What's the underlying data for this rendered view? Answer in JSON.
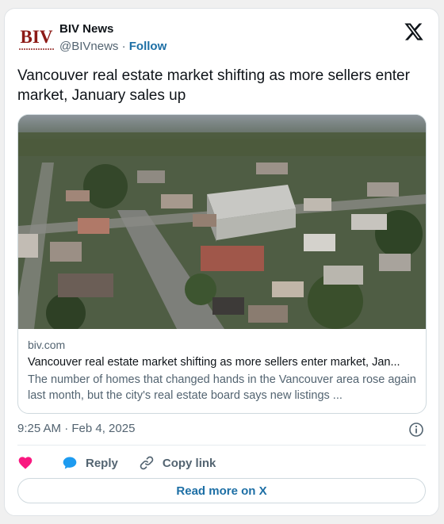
{
  "author": {
    "avatar_text": "BIV",
    "name": "BIV News",
    "handle": "@BIVnews",
    "separator": "·",
    "follow_label": "Follow"
  },
  "tweet": {
    "text": "Vancouver real estate market shifting as more sellers enter market, January sales up"
  },
  "link_card": {
    "domain": "biv.com",
    "title": "Vancouver real estate market shifting as more sellers enter market, Jan...",
    "description": "The number of homes that changed hands in the Vancouver area rose again last month, but the city's real estate board says new listings ...",
    "image_alt": "aerial-neighbourhood-photo"
  },
  "meta": {
    "timestamp": "9:25 AM · Feb 4, 2025"
  },
  "actions": {
    "like_label": "",
    "reply_label": "Reply",
    "copy_link_label": "Copy link",
    "read_more_label": "Read more on X"
  },
  "colors": {
    "like": "#f91880",
    "reply": "#1d9bf0",
    "link": "#1d6fa5",
    "brand_red": "#8c1a16"
  }
}
